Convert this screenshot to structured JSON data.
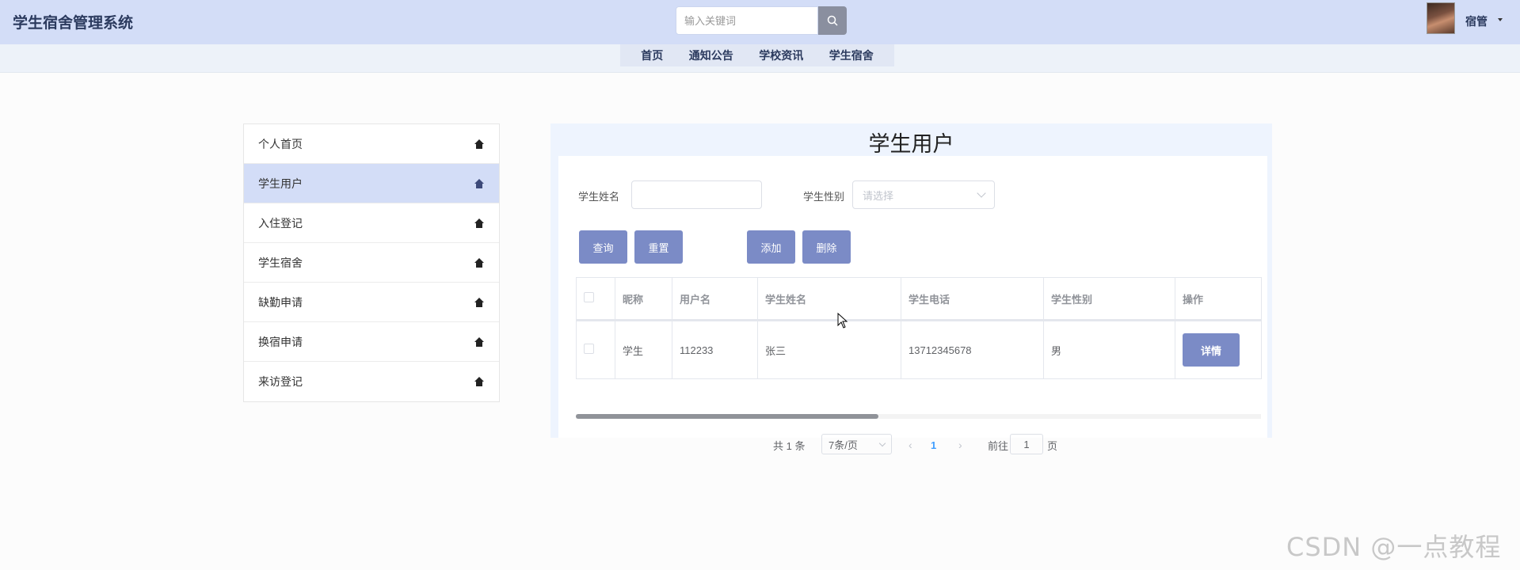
{
  "header": {
    "app_title": "学生宿舍管理系统",
    "search_placeholder": "输入关键词",
    "user_name": "宿管"
  },
  "nav": {
    "items": [
      "首页",
      "通知公告",
      "学校资讯",
      "学生宿舍"
    ]
  },
  "sidebar": {
    "items": [
      {
        "label": "个人首页",
        "active": false
      },
      {
        "label": "学生用户",
        "active": true
      },
      {
        "label": "入住登记",
        "active": false
      },
      {
        "label": "学生宿舍",
        "active": false
      },
      {
        "label": "缺勤申请",
        "active": false
      },
      {
        "label": "换宿申请",
        "active": false
      },
      {
        "label": "来访登记",
        "active": false
      }
    ]
  },
  "main": {
    "title": "学生用户",
    "filters": {
      "name_label": "学生姓名",
      "name_value": "",
      "gender_label": "学生性别",
      "gender_placeholder": "请选择"
    },
    "buttons": {
      "query": "查询",
      "reset": "重置",
      "add": "添加",
      "delete": "删除"
    },
    "table": {
      "headers": [
        "",
        "昵称",
        "用户名",
        "学生姓名",
        "学生电话",
        "学生性别",
        "操作"
      ],
      "rows": [
        {
          "nickname": "学生",
          "username": "112233",
          "name": "张三",
          "phone": "13712345678",
          "gender": "男",
          "action": "详情"
        }
      ]
    },
    "pagination": {
      "total": "共 1 条",
      "page_size": "7条/页",
      "prev": "‹",
      "current_page": "1",
      "next": "›",
      "jump_prefix": "前往",
      "jump_value": "1",
      "jump_suffix": "页"
    }
  },
  "watermark": "CSDN @一点教程",
  "colors": {
    "header_bg": "#d3ddf7",
    "accent_button": "#7b8bc6",
    "active_sidebar": "#d3ddf7",
    "page_link": "#409eff"
  }
}
